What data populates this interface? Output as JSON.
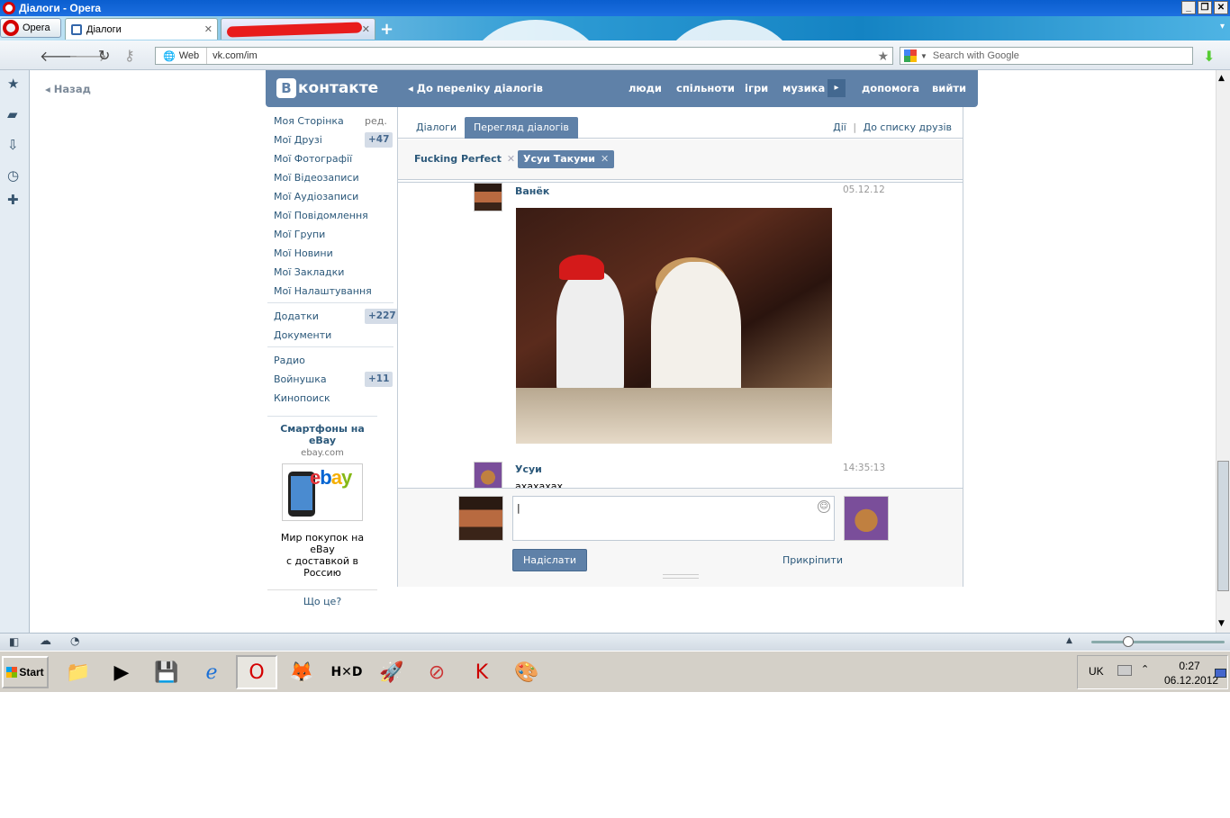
{
  "window": {
    "title": "Діалоги - Opera",
    "buttons": {
      "minimize": "_",
      "maximize": "❐",
      "close": "✕"
    }
  },
  "tabs": {
    "opera_menu": "Opera",
    "items": [
      {
        "label": "Діалоги",
        "active": true
      },
      {
        "label": "",
        "active": false,
        "redacted": true
      }
    ],
    "new_tab": "+",
    "tab_menu": "▾"
  },
  "navbar": {
    "web_label": "Web",
    "url": "vk.com/im",
    "search_placeholder": "Search with Google",
    "icons": [
      "back-icon",
      "forward-icon",
      "reload-icon",
      "key-icon",
      "star-icon",
      "download-icon"
    ]
  },
  "side_panel": {
    "icons": [
      "bookmarks-icon",
      "notes-icon",
      "downloads-icon",
      "history-icon",
      "add-panel-icon"
    ]
  },
  "vk": {
    "logo_letter": "В",
    "logo_text": "контакте",
    "back_to_list": "◂ До переліку діалогів",
    "nav": [
      "люди",
      "спільноти",
      "ігри",
      "музика"
    ],
    "play": "▸",
    "help": "допомога",
    "logout": "вийти",
    "back": "◂ Назад"
  },
  "menu": {
    "my_page": "Моя Сторінка",
    "edit": "ред.",
    "items": [
      {
        "label": "Мої Друзі",
        "badge": "+47"
      },
      {
        "label": "Мої Фотографії",
        "badge": ""
      },
      {
        "label": "Мої Відеозаписи",
        "badge": ""
      },
      {
        "label": "Мої Аудіозаписи",
        "badge": ""
      },
      {
        "label": "Мої Повідомлення",
        "badge": ""
      },
      {
        "label": "Мої Групи",
        "badge": ""
      },
      {
        "label": "Мої Новини",
        "badge": ""
      },
      {
        "label": "Мої Закладки",
        "badge": ""
      },
      {
        "label": "Мої Налаштування",
        "badge": ""
      }
    ],
    "apps": [
      {
        "label": "Додатки",
        "badge": "+227"
      },
      {
        "label": "Документи",
        "badge": ""
      }
    ],
    "extra": [
      {
        "label": "Радио",
        "badge": ""
      },
      {
        "label": "Войнушка",
        "badge": "+11"
      },
      {
        "label": "Кинопоиск",
        "badge": ""
      }
    ]
  },
  "ad": {
    "title": "Смартфоны на eBay",
    "domain": "ebay.com",
    "logo": {
      "e": "e",
      "b": "b",
      "a": "a",
      "y": "y"
    },
    "description_line1": "Мир покупок на eBay",
    "description_line2": "с доставкой в Россию",
    "what": "Що це?"
  },
  "dialogs": {
    "tab_dialogs": "Діалоги",
    "tab_view": "Перегляд діалогів",
    "actions": "Дії",
    "separator": "|",
    "to_friends": "До списку друзів",
    "chips": [
      {
        "label": "Fucking Perfect",
        "selected": false
      },
      {
        "label": "Усуи Такуми",
        "selected": true
      }
    ],
    "close_glyph": "✕",
    "messages": [
      {
        "name": "Ванёк",
        "time": "05.12.12",
        "text": "",
        "has_photo": true
      },
      {
        "name": "Усуи",
        "time": "14:35:13",
        "text": "ахахахах",
        "has_photo": false
      }
    ],
    "compose": {
      "value": "|",
      "smile": "☺",
      "send": "Надіслати",
      "attach": "Прикріпити"
    }
  },
  "taskbar": {
    "start": "Start",
    "apps": [
      "explorer-icon",
      "media-player-icon",
      "save-icon",
      "ie-icon",
      "opera-icon",
      "firefox-icon",
      "hxd-icon",
      "rocket-icon",
      "cleaner-icon",
      "kaspersky-icon",
      "paint-icon"
    ],
    "lang": "UK",
    "time": "0:27",
    "date": "06.12.2012"
  }
}
